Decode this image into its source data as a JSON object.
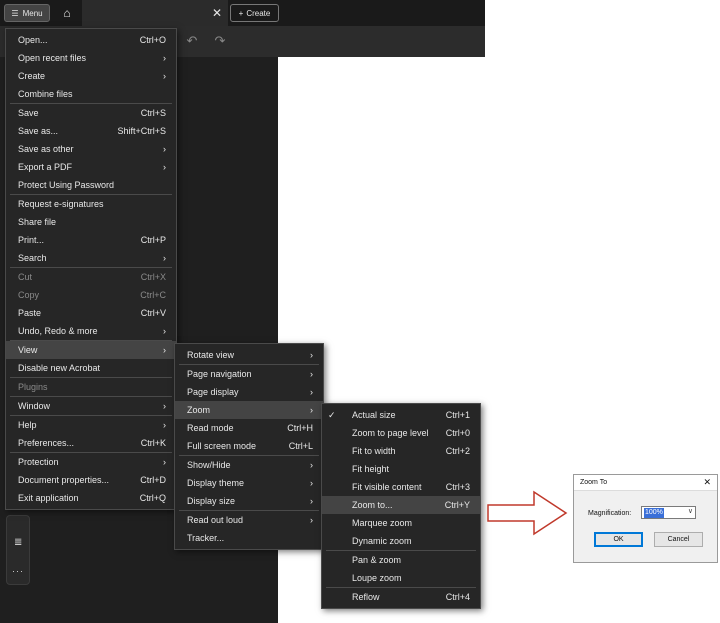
{
  "toolbar": {
    "menu_label": "Menu",
    "create_label": "Create"
  },
  "main_menu": {
    "items": [
      {
        "label": "Open...",
        "shortcut": "Ctrl+O"
      },
      {
        "label": "Open recent files",
        "shortcut": ">"
      },
      {
        "label": "Create",
        "shortcut": ">"
      },
      {
        "label": "Combine files",
        "shortcut": ""
      },
      {
        "label": "Save",
        "shortcut": "Ctrl+S"
      },
      {
        "label": "Save as...",
        "shortcut": "Shift+Ctrl+S"
      },
      {
        "label": "Save as other",
        "shortcut": ">"
      },
      {
        "label": "Export a PDF",
        "shortcut": ">"
      },
      {
        "label": "Protect Using Password",
        "shortcut": ""
      },
      {
        "label": "Request e-signatures",
        "shortcut": ""
      },
      {
        "label": "Share file",
        "shortcut": ""
      },
      {
        "label": "Print...",
        "shortcut": "Ctrl+P"
      },
      {
        "label": "Search",
        "shortcut": ">"
      },
      {
        "label": "Cut",
        "shortcut": "Ctrl+X"
      },
      {
        "label": "Copy",
        "shortcut": "Ctrl+C"
      },
      {
        "label": "Paste",
        "shortcut": "Ctrl+V"
      },
      {
        "label": "Undo, Redo & more",
        "shortcut": ">"
      },
      {
        "label": "View",
        "shortcut": ">"
      },
      {
        "label": "Disable new Acrobat",
        "shortcut": ""
      },
      {
        "label": "Plugins",
        "shortcut": ""
      },
      {
        "label": "Window",
        "shortcut": ">"
      },
      {
        "label": "Help",
        "shortcut": ">"
      },
      {
        "label": "Preferences...",
        "shortcut": "Ctrl+K"
      },
      {
        "label": "Protection",
        "shortcut": ">"
      },
      {
        "label": "Document properties...",
        "shortcut": "Ctrl+D"
      },
      {
        "label": "Exit application",
        "shortcut": "Ctrl+Q"
      }
    ]
  },
  "view_menu": {
    "items": [
      {
        "label": "Rotate view",
        "shortcut": ">"
      },
      {
        "label": "Page navigation",
        "shortcut": ">"
      },
      {
        "label": "Page display",
        "shortcut": ">"
      },
      {
        "label": "Zoom",
        "shortcut": ">"
      },
      {
        "label": "Read mode",
        "shortcut": "Ctrl+H"
      },
      {
        "label": "Full screen mode",
        "shortcut": "Ctrl+L"
      },
      {
        "label": "Show/Hide",
        "shortcut": ">"
      },
      {
        "label": "Display theme",
        "shortcut": ">"
      },
      {
        "label": "Display size",
        "shortcut": ">"
      },
      {
        "label": "Read out loud",
        "shortcut": ">"
      },
      {
        "label": "Tracker...",
        "shortcut": ""
      }
    ]
  },
  "zoom_menu": {
    "items": [
      {
        "label": "Actual size",
        "shortcut": "Ctrl+1"
      },
      {
        "label": "Zoom to page level",
        "shortcut": "Ctrl+0"
      },
      {
        "label": "Fit to width",
        "shortcut": "Ctrl+2"
      },
      {
        "label": "Fit height",
        "shortcut": ""
      },
      {
        "label": "Fit visible content",
        "shortcut": "Ctrl+3"
      },
      {
        "label": "Zoom to...",
        "shortcut": "Ctrl+Y"
      },
      {
        "label": "Marquee zoom",
        "shortcut": ""
      },
      {
        "label": "Dynamic zoom",
        "shortcut": ""
      },
      {
        "label": "Pan & zoom",
        "shortcut": ""
      },
      {
        "label": "Loupe zoom",
        "shortcut": ""
      },
      {
        "label": "Reflow",
        "shortcut": "Ctrl+4"
      }
    ]
  },
  "dialog": {
    "title": "Zoom To",
    "close_glyph": "✕",
    "magnification_label": "Magnification:",
    "magnification_value": "100%",
    "ok_label": "OK",
    "cancel_label": "Cancel"
  },
  "icons": {
    "hamburger": "☰",
    "home": "⌂",
    "close": "✕",
    "plus": "+",
    "undo": "↶",
    "redo": "↷",
    "check": "✓",
    "submenu": "›",
    "chevron_down": "∨",
    "doc": "≣",
    "more": "···"
  },
  "colors": {
    "arrow_outline": "#c0392b"
  }
}
